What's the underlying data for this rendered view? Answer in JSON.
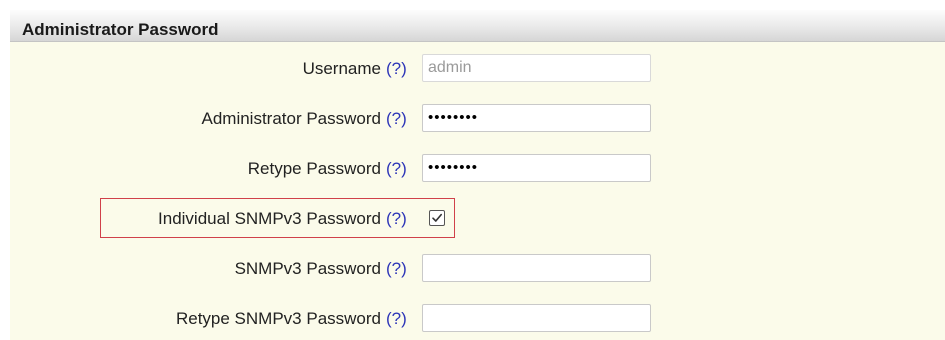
{
  "section": {
    "title": "Administrator Password"
  },
  "help_text": "(?)",
  "rows": [
    {
      "label": "Username",
      "value": "admin"
    },
    {
      "label": "Administrator Password",
      "value": "••••••••"
    },
    {
      "label": "Retype Password",
      "value": "••••••••"
    },
    {
      "label": "Individual SNMPv3 Password",
      "checked": true
    },
    {
      "label": "SNMPv3 Password",
      "value": ""
    },
    {
      "label": "Retype SNMPv3 Password",
      "value": ""
    }
  ],
  "colors": {
    "panel_background": "#fbfbea",
    "help_link": "#2e36b8",
    "highlight_border": "#d0404a"
  }
}
